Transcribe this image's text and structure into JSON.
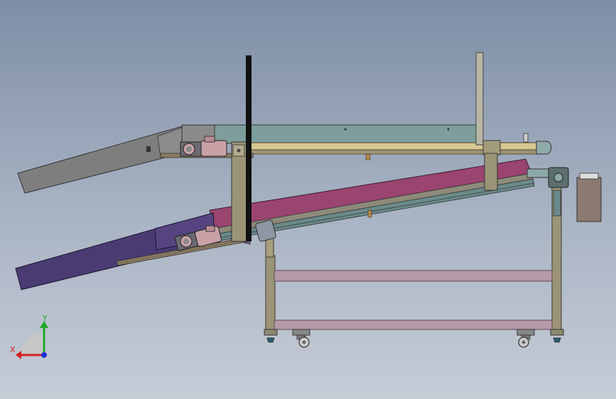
{
  "view": {
    "background_top": "#7f8ea6",
    "background_bottom": "#c6ccd6"
  },
  "triad": {
    "x_label": "X",
    "y_label": "Y",
    "x_color": "#d62020",
    "y_color": "#1faa2a",
    "z_color": "#2030d0"
  },
  "colors": {
    "upper_conveyor": "#7d9e9c",
    "upper_chute": "#7e7e7e",
    "lower_conveyor": "#9a4470",
    "lower_chute": "#4a3b72",
    "frame": "#9c9476",
    "cross_bar": "#b59aa8",
    "motor": "#c9a2a8",
    "control_box": "#8c7a70"
  }
}
